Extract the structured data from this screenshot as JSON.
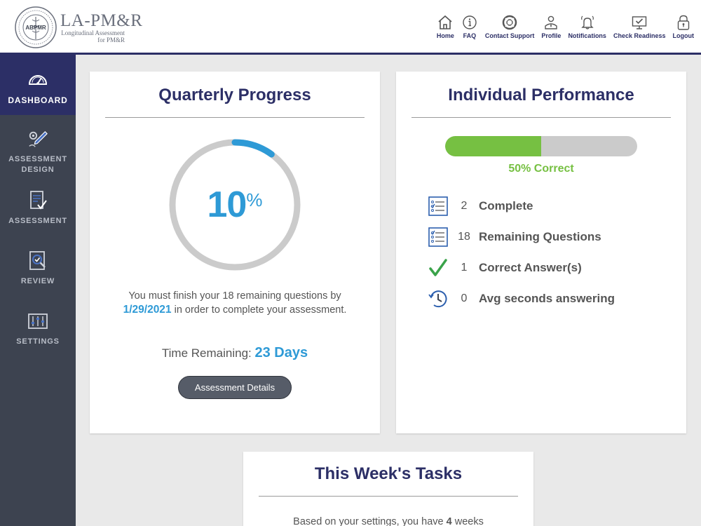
{
  "brand": {
    "title": "LA-PM&R",
    "subtitle": "Longitudinal Assessment for PM&R",
    "seal_text": "ABPMR"
  },
  "topnav": [
    {
      "label": "Home",
      "icon": "home-icon"
    },
    {
      "label": "FAQ",
      "icon": "info-icon"
    },
    {
      "label": "Contact Support",
      "icon": "lifebuoy-icon"
    },
    {
      "label": "Profile",
      "icon": "user-icon"
    },
    {
      "label": "Notifications",
      "icon": "bell-icon"
    },
    {
      "label": "Check Readiness",
      "icon": "monitor-check-icon"
    },
    {
      "label": "Logout",
      "icon": "lock-icon"
    }
  ],
  "sidebar": [
    {
      "label": "DASHBOARD",
      "icon": "gauge-icon",
      "active": true
    },
    {
      "label": "ASSESSMENT DESIGN",
      "icon": "pencil-gear-icon"
    },
    {
      "label": "ASSESSMENT",
      "icon": "document-checklist-icon"
    },
    {
      "label": "REVIEW",
      "icon": "magnifier-check-icon"
    },
    {
      "label": "SETTINGS",
      "icon": "sliders-icon"
    }
  ],
  "quarterly": {
    "title": "Quarterly Progress",
    "percent": "10",
    "percent_value": 10,
    "percent_sign": "%",
    "msg_before": "You must finish your 18 remaining questions by",
    "date": "1/29/2021",
    "msg_after": "in order to complete your assessment.",
    "time_label": "Time Remaining:",
    "time_value": "23 Days",
    "button": "Assessment Details"
  },
  "performance": {
    "title": "Individual Performance",
    "bar_percent": 50,
    "bar_label": "50% Correct",
    "stats": [
      {
        "num": "2",
        "label": "Complete",
        "icon": "checklist-icon"
      },
      {
        "num": "18",
        "label": "Remaining Questions",
        "icon": "checklist-icon"
      },
      {
        "num": "1",
        "label": "Correct Answer(s)",
        "icon": "checkmark-icon"
      },
      {
        "num": "0",
        "label": "Avg seconds answering",
        "icon": "clock-icon"
      }
    ]
  },
  "tasks": {
    "title": "This Week's Tasks",
    "msg_before": "Based on your settings, you have",
    "msg_bold": "4",
    "msg_after": "weeks"
  },
  "colors": {
    "navy": "#2c2f66",
    "blue": "#2e9ad6",
    "green": "#76c042",
    "sidebar": "#3d4350"
  }
}
